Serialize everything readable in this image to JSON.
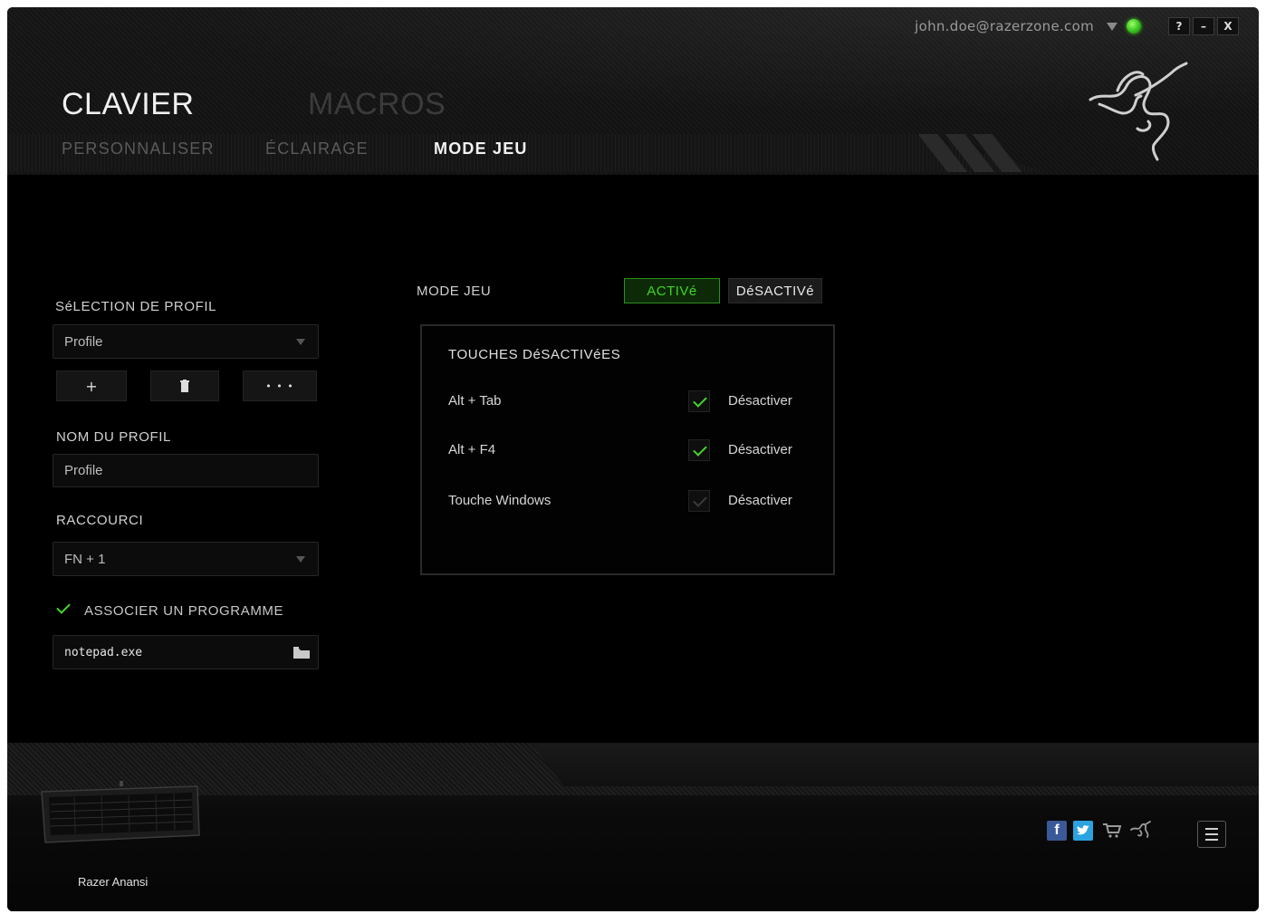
{
  "account": {
    "email": "john.doe@razerzone.com"
  },
  "window_buttons": {
    "help": "?",
    "minimize": "–",
    "close": "X"
  },
  "main_tabs": [
    {
      "label": "CLAVIER"
    },
    {
      "label": "MACROS"
    }
  ],
  "sub_tabs": [
    {
      "label": "PERSONNALISER"
    },
    {
      "label": "ÉCLAIRAGE"
    },
    {
      "label": "MODE JEU"
    }
  ],
  "profile": {
    "selection_label": "SéLECTION DE PROFIL",
    "selected_profile": "Profile",
    "add_label": "+",
    "more_label": "• • •",
    "name_label": "NOM DU PROFIL",
    "name_value": "Profile",
    "shortcut_label": "RACCOURCI",
    "shortcut_value": "FN + 1",
    "link_program_label": "ASSOCIER UN PROGRAMME",
    "link_program_checked": true,
    "program_value": "notepad.exe"
  },
  "game_mode": {
    "label": "MODE JEU",
    "on_label": "ACTIVé",
    "off_label": "DéSACTIVé",
    "state": "on",
    "disabled_keys_title": "TOUCHES DéSACTIVéES",
    "keys": [
      {
        "name": "Alt + Tab",
        "action": "Désactiver",
        "checked": true
      },
      {
        "name": "Alt + F4",
        "action": "Désactiver",
        "checked": true
      },
      {
        "name": "Touche Windows",
        "action": "Désactiver",
        "checked": false
      }
    ]
  },
  "footer": {
    "device_name": "Razer Anansi"
  },
  "colors": {
    "accent": "#44d62c",
    "background": "#000000"
  }
}
